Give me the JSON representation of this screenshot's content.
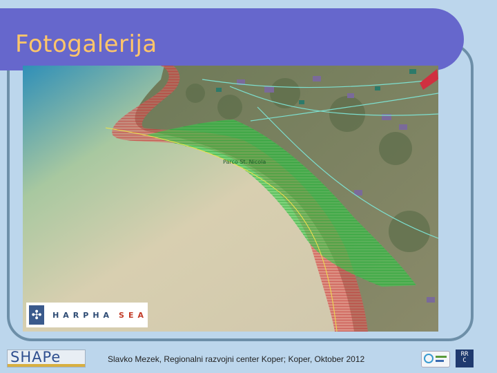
{
  "slide": {
    "title": "Fotogalerija",
    "footer": "Slavko Mezek, Regionalni razvojni center Koper; Koper, Oktober 2012"
  },
  "photo": {
    "map_label": "Parco St. Nicola",
    "logo_name": "HARPHA",
    "logo_suffix": "SEA"
  },
  "logos": {
    "shape": "SHAPe",
    "rrc_top": "RR",
    "rrc_bottom": "C"
  },
  "colors": {
    "title_bar": "#6667cc",
    "title_text": "#ffc66a",
    "background": "#bcd6ec",
    "zone_green": "#2ecc40",
    "zone_red": "#e0484a"
  }
}
